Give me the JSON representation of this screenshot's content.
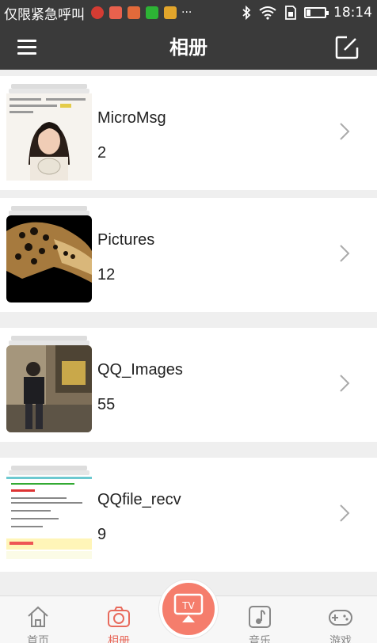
{
  "status_bar": {
    "carrier_text": "仅限紧急呼叫",
    "more": "···",
    "time": "18:14",
    "notification_icons": [
      "netease-music-icon",
      "mail-icon",
      "app-icon",
      "wechat-icon",
      "notes-icon"
    ]
  },
  "header": {
    "title": "相册",
    "menu_icon": "menu-icon",
    "edit_icon": "edit-icon"
  },
  "albums": [
    {
      "name": "MicroMsg",
      "count": "2"
    },
    {
      "name": "Pictures",
      "count": "12"
    },
    {
      "name": "QQ_Images",
      "count": "55"
    },
    {
      "name": "QQfile_recv",
      "count": "9"
    }
  ],
  "tabbar": {
    "tabs": [
      {
        "label": "首页",
        "icon": "home-icon",
        "active": false
      },
      {
        "label": "相册",
        "icon": "camera-icon",
        "active": true
      },
      {
        "label": "音乐",
        "icon": "music-icon",
        "active": false
      },
      {
        "label": "游戏",
        "icon": "gamepad-icon",
        "active": false
      }
    ],
    "center_button": {
      "label": "TV",
      "icon": "tv-cast-icon"
    }
  },
  "colors": {
    "header_bg": "#3a3a3a",
    "accent": "#e86a5c",
    "tv_button": "#f57d6c",
    "background": "#efefef"
  }
}
